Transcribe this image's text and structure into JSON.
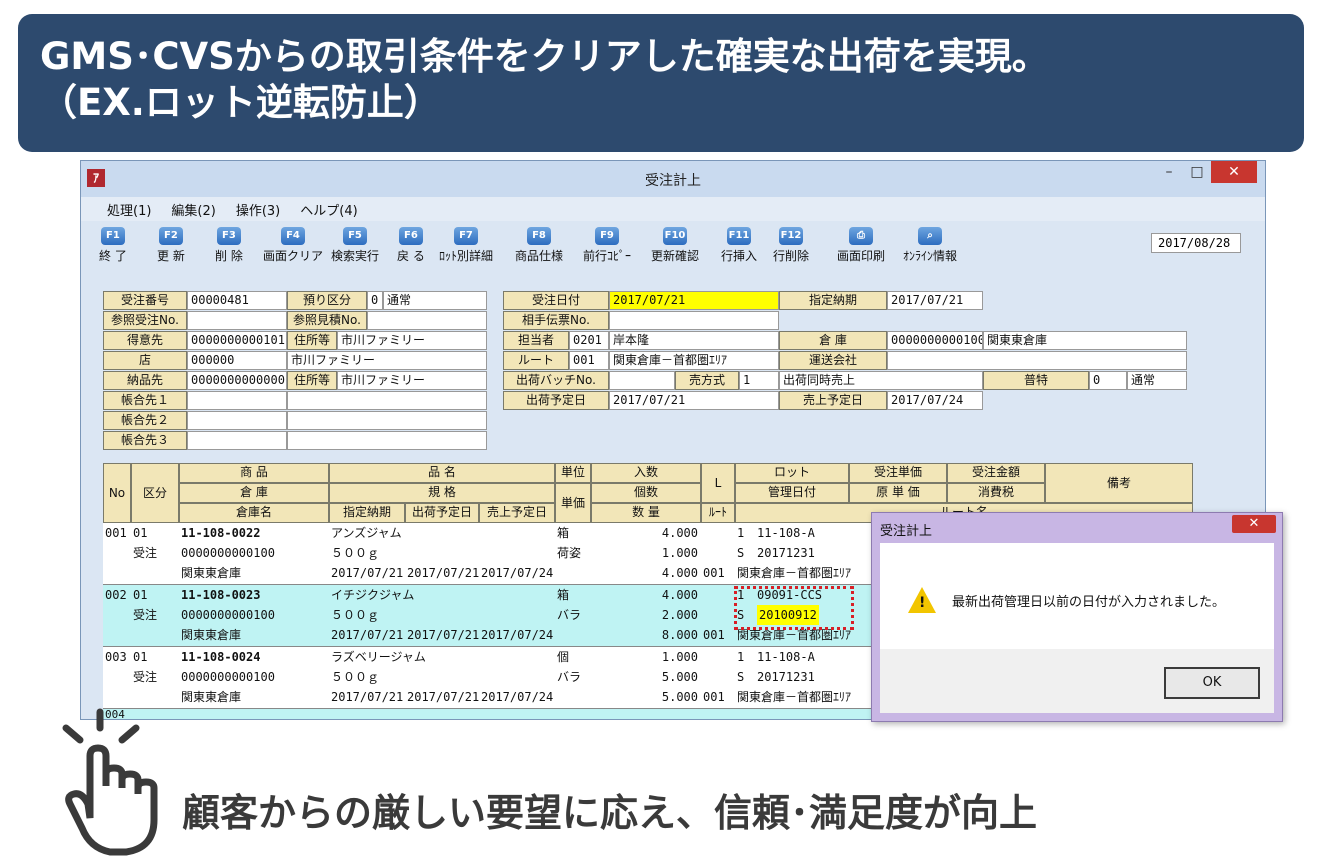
{
  "banner": {
    "line1": "GMS･CVSからの取引条件をクリアした確実な出荷を実現。",
    "line2": "（EX.ロット逆転防止）"
  },
  "window": {
    "title": "受注計上",
    "icon": "ｱ",
    "min": "–",
    "max": "□",
    "close": "✕"
  },
  "menu": [
    "処理(1)",
    "編集(2)",
    "操作(3)",
    "ヘルプ(4)"
  ],
  "toolbar": [
    {
      "key": "F1",
      "label": "終 了"
    },
    {
      "key": "F2",
      "label": "更 新"
    },
    {
      "key": "F3",
      "label": "削 除"
    },
    {
      "key": "F4",
      "label": "画面クリア"
    },
    {
      "key": "F5",
      "label": "検索実行"
    },
    {
      "key": "F6",
      "label": "戻 る"
    },
    {
      "key": "F7",
      "label": "ﾛｯﾄ別詳細"
    },
    {
      "key": "F8",
      "label": "商品仕様"
    },
    {
      "key": "F9",
      "label": "前行ｺﾋﾟｰ"
    },
    {
      "key": "F10",
      "label": "更新確認"
    },
    {
      "key": "F11",
      "label": "行挿入"
    },
    {
      "key": "F12",
      "label": "行削除"
    },
    {
      "key": "⎙",
      "label": "画面印刷"
    },
    {
      "key": "⌕",
      "label": "ｵﾝﾗｲﾝ情報"
    }
  ],
  "toolbar_date": "2017/08/28",
  "labels": {
    "juchu_no": "受注番号",
    "sansho_juchu": "参照受注No.",
    "tokuisaki": "得意先",
    "mise": "店",
    "nohinsaki": "納品先",
    "chogo1": "帳合先１",
    "chogo2": "帳合先２",
    "chogo3": "帳合先３",
    "azukari": "預り区分",
    "sansho_mitsumori": "参照見積No.",
    "jusho1": "住所等",
    "jusho2": "住所等",
    "juchu_date": "受注日付",
    "aite": "相手伝票No.",
    "tanto": "担当者",
    "route": "ルート",
    "batch": "出荷バッチNo.",
    "shuka_yotei": "出荷予定日",
    "urihoshiki": "売方式",
    "shitei": "指定納期",
    "soko": "倉 庫",
    "unso": "運送会社",
    "uriage_yotei": "売上予定日",
    "futoku": "普特"
  },
  "values": {
    "juchu_no": "00000481",
    "azukari_code": "0",
    "azukari_name": "通常",
    "tokuisaki_code": "0000000000101",
    "tokuisaki_name": "市川ファミリー",
    "mise_code": "000000",
    "mise_name": "市川ファミリー",
    "nohinsaki_code": "0000000000000",
    "nohinsaki_name": "市川ファミリー",
    "juchu_date": "2017/07/21",
    "shitei": "2017/07/21",
    "tanto_code": "0201",
    "tanto_name": "岸本隆",
    "route_code": "001",
    "route_name": "関東倉庫－首都圏ｴﾘｱ",
    "soko_code": "0000000000100",
    "soko_name": "関東東倉庫",
    "urihoshiki_code": "1",
    "urihoshiki_name": "出荷同時売上",
    "futoku_code": "0",
    "futoku_name": "通常",
    "shuka_yotei": "2017/07/21",
    "uriage_yotei": "2017/07/24"
  },
  "grid_headers": {
    "no": "No",
    "kubun": "区分",
    "shohin": "商 品",
    "soko": "倉 庫",
    "sokomei": "倉庫名",
    "hinmei": "品 名",
    "kikaku": "規 格",
    "shitei": "指定納期",
    "shuka": "出荷予定日",
    "uriage": "売上予定日",
    "tani": "単位",
    "tanka": "単価",
    "irisu": "入数",
    "kosu": "個数",
    "suryo": "数 量",
    "l": "L",
    "route": "ﾙｰﾄ",
    "lot": "ロット",
    "kanri": "管理日付",
    "routemei": "ルート名",
    "juchu_tanka": "受注単価",
    "genka": "原 単 価",
    "kingaku": "受注金額",
    "shohizei": "消費税",
    "biko": "備考"
  },
  "rows": [
    {
      "no": "001",
      "kubun1": "01",
      "kubun2": "受注",
      "code": "11-108-0022",
      "soko": "0000000000100",
      "sokomei": "関東東倉庫",
      "name": "アンズジャム",
      "spec": "５００ｇ",
      "d1": "2017/07/21",
      "d2": "2017/07/21",
      "d3": "2017/07/24",
      "unit1": "箱",
      "unit2": "荷姿",
      "q1": "4.000",
      "q2": "1.000",
      "q3": "4.000",
      "route": "001",
      "l1": "1",
      "lot": "11-108-A",
      "l2": "S",
      "kanri": "20171231",
      "routemei": "関東倉庫－首都圏ｴﾘｱ"
    },
    {
      "no": "002",
      "kubun1": "01",
      "kubun2": "受注",
      "code": "11-108-0023",
      "soko": "0000000000100",
      "sokomei": "関東東倉庫",
      "name": "イチジクジャム",
      "spec": "５００ｇ",
      "d1": "2017/07/21",
      "d2": "2017/07/21",
      "d3": "2017/07/24",
      "unit1": "箱",
      "unit2": "バラ",
      "q1": "4.000",
      "q2": "2.000",
      "q3": "8.000",
      "route": "001",
      "l1": "1",
      "lot": "09091-CCS",
      "l2": "S",
      "kanri": "20100912",
      "routemei": "関東倉庫－首都圏ｴﾘｱ"
    },
    {
      "no": "003",
      "kubun1": "01",
      "kubun2": "受注",
      "code": "11-108-0024",
      "soko": "0000000000100",
      "sokomei": "関東東倉庫",
      "name": "ラズベリージャム",
      "spec": "５００ｇ",
      "d1": "2017/07/21",
      "d2": "2017/07/21",
      "d3": "2017/07/24",
      "unit1": "個",
      "unit2": "バラ",
      "q1": "1.000",
      "q2": "5.000",
      "q3": "5.000",
      "route": "001",
      "l1": "1",
      "lot": "11-108-A",
      "l2": "S",
      "kanri": "20171231",
      "routemei": "関東倉庫－首都圏ｴﾘｱ"
    }
  ],
  "row4_no": "004",
  "dialog": {
    "title": "受注計上",
    "close": "✕",
    "message": "最新出荷管理日以前の日付が入力されました。",
    "ok": "OK",
    "warn": "!"
  },
  "bottom_text": "顧客からの厳しい要望に応え、信頼･満足度が向上",
  "colors": {
    "banner": "#2d4a6e",
    "highlight": "#ffff00",
    "selected_row": "#bff3f3",
    "red_marker": "#d81f26"
  }
}
